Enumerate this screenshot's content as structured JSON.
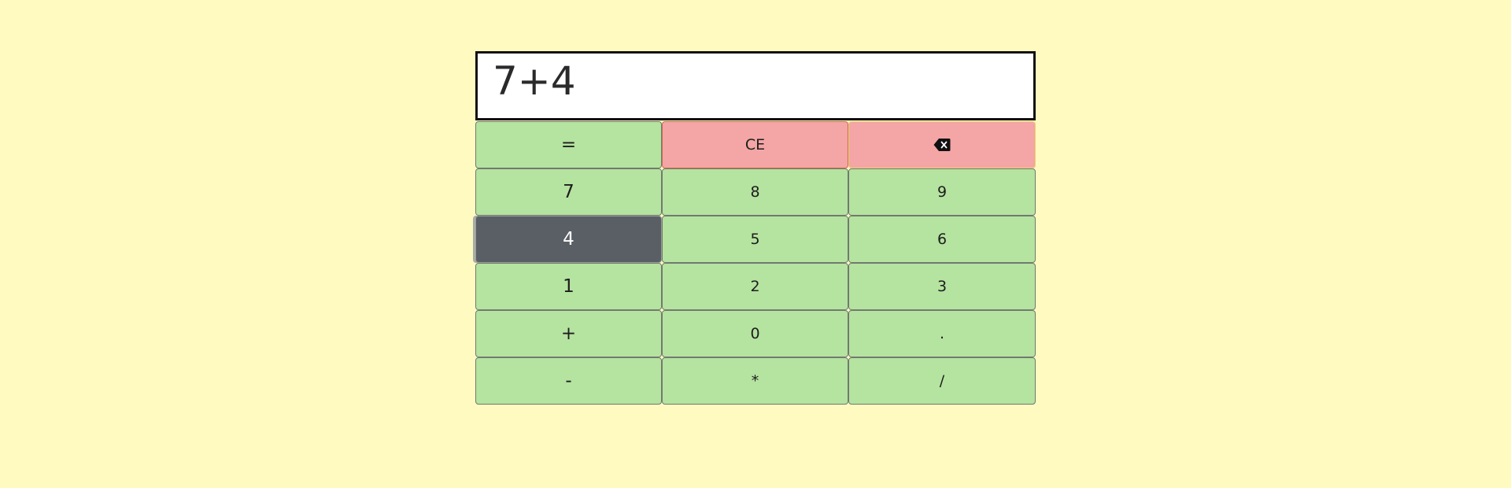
{
  "display": {
    "expression": "7+4"
  },
  "keys": [
    {
      "label": "=",
      "name": "equals-button"
    },
    {
      "label": "CE",
      "name": "clear-entry-button"
    },
    {
      "label": "",
      "name": "backspace-button",
      "icon": "backspace-icon"
    },
    {
      "label": "7",
      "name": "digit-7-button"
    },
    {
      "label": "8",
      "name": "digit-8-button"
    },
    {
      "label": "9",
      "name": "digit-9-button"
    },
    {
      "label": "4",
      "name": "digit-4-button",
      "state": "active"
    },
    {
      "label": "5",
      "name": "digit-5-button"
    },
    {
      "label": "6",
      "name": "digit-6-button"
    },
    {
      "label": "1",
      "name": "digit-1-button"
    },
    {
      "label": "2",
      "name": "digit-2-button"
    },
    {
      "label": "3",
      "name": "digit-3-button"
    },
    {
      "label": "+",
      "name": "plus-button"
    },
    {
      "label": "0",
      "name": "digit-0-button"
    },
    {
      "label": ".",
      "name": "decimal-point-button"
    },
    {
      "label": "-",
      "name": "minus-button"
    },
    {
      "label": "*",
      "name": "multiply-button"
    },
    {
      "label": "/",
      "name": "divide-button"
    }
  ],
  "colors": {
    "background": "#fffac0",
    "key": "#b5e3a0",
    "danger_key": "#f4a5a5",
    "active_key": "#5a5f66"
  }
}
